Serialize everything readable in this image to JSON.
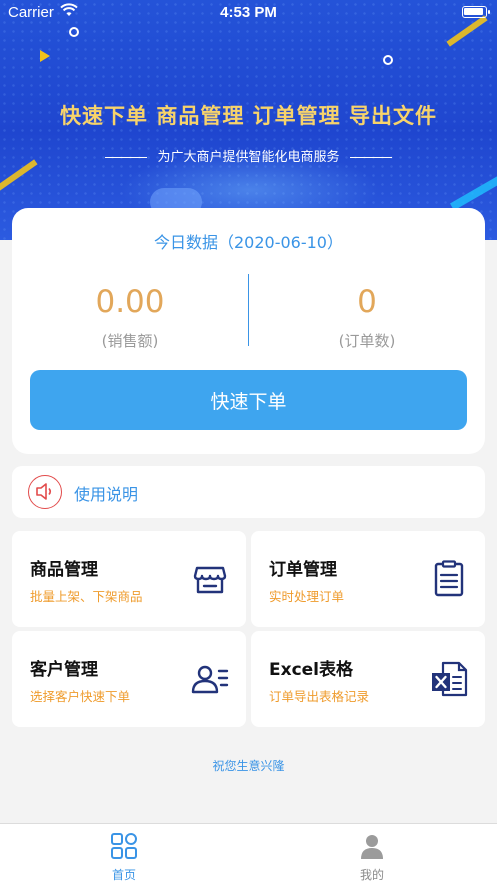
{
  "status_bar": {
    "carrier": "Carrier",
    "time": "4:53 PM"
  },
  "hero": {
    "title": "快速下单  商品管理  订单管理  导出文件",
    "subtitle": "为广大商户提供智能化电商服务"
  },
  "today": {
    "heading": "今日数据（2020-06-10）",
    "sales_value": "0.00",
    "sales_label": "(销售额)",
    "orders_value": "0",
    "orders_label": "(订单数)",
    "quick_order_label": "快速下单"
  },
  "notice": {
    "label": "使用说明",
    "icon": "speaker-icon"
  },
  "tiles": [
    {
      "title": "商品管理",
      "subtitle": "批量上架、下架商品",
      "icon": "store-icon"
    },
    {
      "title": "订单管理",
      "subtitle": "实时处理订单",
      "icon": "clipboard-icon"
    },
    {
      "title": "客户管理",
      "subtitle": "选择客户快速下单",
      "icon": "contact-list-icon"
    },
    {
      "title": "Excel表格",
      "subtitle": "订单导出表格记录",
      "icon": "excel-icon"
    }
  ],
  "footer_text": "祝您生意兴隆",
  "tabbar": {
    "home_label": "首页",
    "mine_label": "我的"
  },
  "colors": {
    "hero_blue": "#2453d8",
    "accent_blue": "#3a94e6",
    "button_blue": "#3ea5ef",
    "gold": "#e2a75a",
    "orange": "#ef9c2e",
    "icon_navy": "#22337a",
    "alert_red": "#e24b4b"
  }
}
